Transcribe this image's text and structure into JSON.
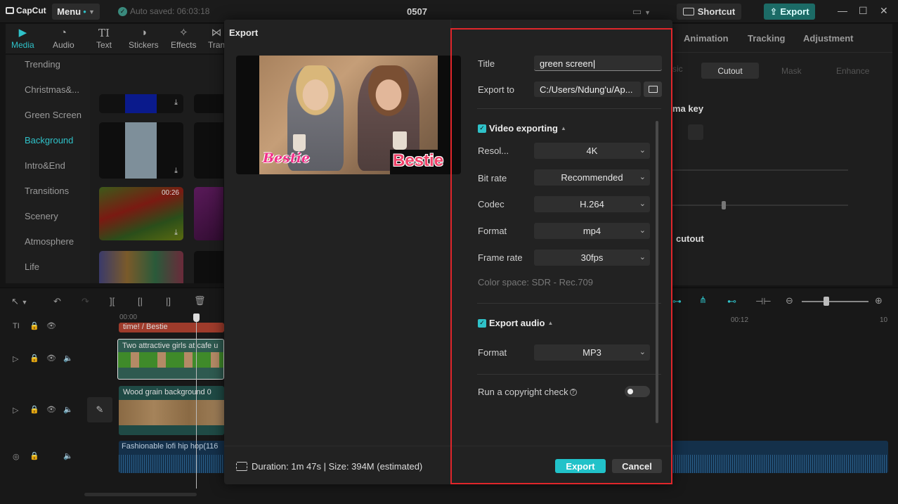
{
  "titlebar": {
    "app_name": "CapCut",
    "menu_label": "Menu",
    "autosave": "Auto saved: 06:03:18",
    "project_title": "0507",
    "shortcut_label": "Shortcut",
    "export_label": "Export"
  },
  "tool_tabs": [
    "Media",
    "Audio",
    "Text",
    "Stickers",
    "Effects",
    "Tran"
  ],
  "categories": [
    "Trending",
    "Christmas&...",
    "Green Screen",
    "Background",
    "Intro&End",
    "Transitions",
    "Scenery",
    "Atmosphere",
    "Life"
  ],
  "thumb_duration": "00:26",
  "props": {
    "tabs": [
      "Animation",
      "Tracking",
      "Adjustment"
    ],
    "subtabs": [
      "sic",
      "Cutout",
      "Mask",
      "Enhance"
    ],
    "chroma_key": "ma key",
    "cutout": "cutout"
  },
  "timeline": {
    "ticks": [
      "00:00",
      "00:12",
      "10"
    ],
    "tracks": {
      "text": "time! / Bestie",
      "video": "Two attractive girls at cafe u",
      "bg": "Wood grain background   0",
      "audio": "Fashionable lofi hip hop(116"
    }
  },
  "dialog": {
    "title": "Export",
    "preview_captions": [
      "Bestie",
      "Bestie"
    ],
    "fields": {
      "title_label": "Title",
      "title_value": "green screen",
      "export_to_label": "Export to",
      "export_to_value": "C:/Users/Ndung'u/Ap..."
    },
    "video": {
      "section": "Video exporting",
      "resolution_label": "Resol...",
      "resolution_value": "4K",
      "bitrate_label": "Bit rate",
      "bitrate_value": "Recommended",
      "codec_label": "Codec",
      "codec_value": "H.264",
      "format_label": "Format",
      "format_value": "mp4",
      "framerate_label": "Frame rate",
      "framerate_value": "30fps",
      "color_space": "Color space: SDR - Rec.709"
    },
    "audio": {
      "section": "Export audio",
      "format_label": "Format",
      "format_value": "MP3"
    },
    "copyright_label": "Run a copyright check",
    "copyright_enabled": false,
    "duration": "Duration: 1m 47s | Size: 394M (estimated)",
    "export_button": "Export",
    "cancel_button": "Cancel"
  },
  "colors": {
    "accent": "#21c2c9",
    "highlight": "#e0262b",
    "dialog_bg": "#222222"
  }
}
